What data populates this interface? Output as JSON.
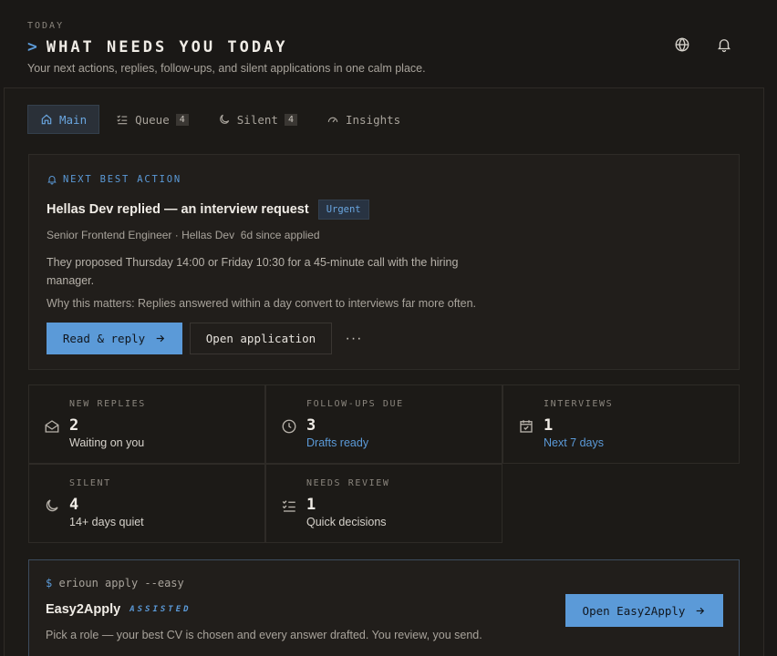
{
  "header": {
    "eyebrow": "TODAY",
    "chevron": ">",
    "title": "WHAT NEEDS YOU TODAY",
    "subtitle": "Your next actions, replies, follow-ups, and silent applications in one calm place.",
    "language_icon": "globe-icon",
    "notifications_icon": "bell-icon"
  },
  "tabs": [
    {
      "label": "Main",
      "icon": "home-icon",
      "active": true
    },
    {
      "label": "Queue",
      "icon": "list-check-icon",
      "count": "4"
    },
    {
      "label": "Silent",
      "icon": "moon-icon",
      "count": "4"
    },
    {
      "label": "Insights",
      "icon": "gauge-icon"
    }
  ],
  "next_action": {
    "eyebrow": "NEXT BEST ACTION",
    "title": "Hellas Dev replied — an interview request",
    "badge": "Urgent",
    "meta": "Senior Frontend Engineer · Hellas Dev  6d since applied",
    "description": "They proposed Thursday 14:00 or Friday 10:30 for a 45-minute call with the hiring manager.",
    "why": "Why this matters: Replies answered within a day convert to interviews far more often.",
    "primary_label": "Read & reply",
    "secondary_label": "Open application",
    "more_label": "···"
  },
  "stats": [
    {
      "label": "NEW REPLIES",
      "value": "2",
      "sub": "Waiting on you",
      "icon": "mail-open-icon"
    },
    {
      "label": "FOLLOW-UPS DUE",
      "value": "3",
      "sub": "Drafts ready",
      "icon": "clock-icon"
    },
    {
      "label": "INTERVIEWS",
      "value": "1",
      "sub": "Next 7 days",
      "icon": "calendar-check-icon"
    },
    {
      "label": "SILENT",
      "value": "4",
      "sub": "14+ days quiet",
      "icon": "moon-icon"
    },
    {
      "label": "NEEDS REVIEW",
      "value": "1",
      "sub": "Quick decisions",
      "icon": "list-check-icon"
    }
  ],
  "easy2apply": {
    "prompt": "$",
    "command": "erioun apply --easy",
    "name": "Easy2Apply",
    "tag": "ASSISTED",
    "description": "Pick a role — your best CV is chosen and every answer drafted. You review, you send.",
    "button_label": "Open Easy2Apply"
  },
  "colors": {
    "background": "#1a1816",
    "accent": "#5b9ad8",
    "text": "#e6e2dc",
    "muted": "#a8a39b"
  }
}
